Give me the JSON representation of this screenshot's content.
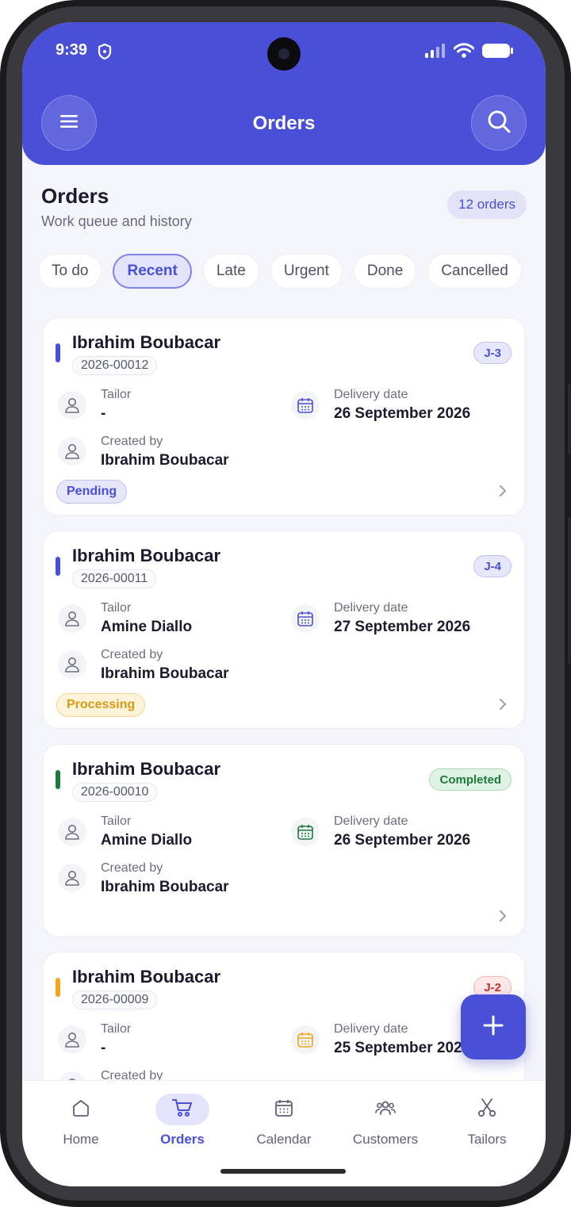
{
  "status_bar": {
    "time": "9:39"
  },
  "appbar": {
    "title": "Orders"
  },
  "header": {
    "title": "Orders",
    "subtitle": "Work queue and history",
    "count": "12 orders"
  },
  "filters": [
    {
      "label": "To do",
      "active": false
    },
    {
      "label": "Recent",
      "active": true
    },
    {
      "label": "Late",
      "active": false
    },
    {
      "label": "Urgent",
      "active": false
    },
    {
      "label": "Done",
      "active": false
    },
    {
      "label": "Cancelled",
      "active": false
    }
  ],
  "field_labels": {
    "tailor": "Tailor",
    "created_by": "Created by",
    "delivery_date": "Delivery date"
  },
  "orders": [
    {
      "customer": "Ibrahim Boubacar",
      "number": "2026-00012",
      "badge": "J-3",
      "tailor": "-",
      "delivery_date": "26 September 2026",
      "created_by": "Ibrahim Boubacar",
      "status": "Pending",
      "accent": "#4a4fd8"
    },
    {
      "customer": "Ibrahim Boubacar",
      "number": "2026-00011",
      "badge": "J-4",
      "tailor": "Amine Diallo",
      "delivery_date": "27 September 2026",
      "created_by": "Ibrahim Boubacar",
      "status": "Processing",
      "accent": "#4a4fd8"
    },
    {
      "customer": "Ibrahim Boubacar",
      "number": "2026-00010",
      "badge": "Completed",
      "tailor": "Amine Diallo",
      "delivery_date": "26 September 2026",
      "created_by": "Ibrahim Boubacar",
      "status": "",
      "accent": "#1e7a3c"
    },
    {
      "customer": "Ibrahim Boubacar",
      "number": "2026-00009",
      "badge": "J-2",
      "tailor": "-",
      "delivery_date": "25 September 2026",
      "created_by": "",
      "status": "",
      "accent": "#f2a516"
    }
  ],
  "bottom_nav": [
    {
      "label": "Home",
      "icon": "home-icon",
      "active": false
    },
    {
      "label": "Orders",
      "icon": "cart-icon",
      "active": true
    },
    {
      "label": "Calendar",
      "icon": "calendar-icon",
      "active": false
    },
    {
      "label": "Customers",
      "icon": "people-icon",
      "active": false
    },
    {
      "label": "Tailors",
      "icon": "scissors-icon",
      "active": false
    }
  ],
  "colors": {
    "primary": "#4a4fd8",
    "success": "#1e7a3c",
    "warning": "#f2a516",
    "danger": "#c73333"
  }
}
